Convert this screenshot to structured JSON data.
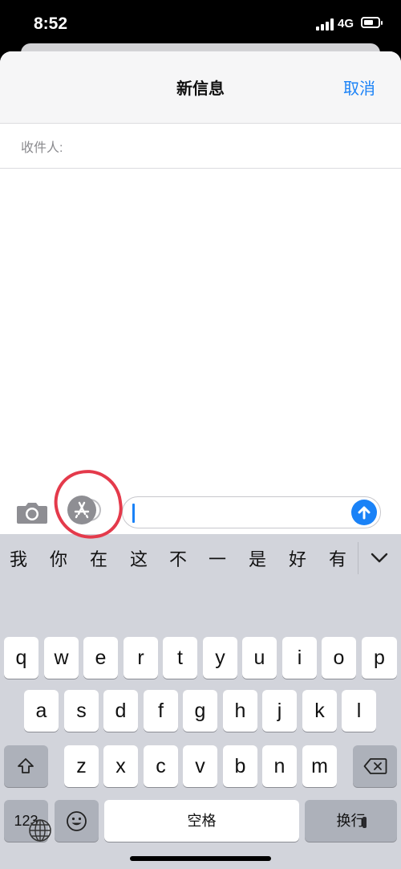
{
  "status": {
    "time": "8:52",
    "network": "4G"
  },
  "nav": {
    "title": "新信息",
    "cancel": "取消"
  },
  "to": {
    "label": "收件人:",
    "value": ""
  },
  "compose": {
    "text": ""
  },
  "candidates": [
    "我",
    "你",
    "在",
    "这",
    "不",
    "一",
    "是",
    "好",
    "有"
  ],
  "keys": {
    "row1": [
      "q",
      "w",
      "e",
      "r",
      "t",
      "y",
      "u",
      "i",
      "o",
      "p"
    ],
    "row2": [
      "a",
      "s",
      "d",
      "f",
      "g",
      "h",
      "j",
      "k",
      "l"
    ],
    "row3": [
      "z",
      "x",
      "c",
      "v",
      "b",
      "n",
      "m"
    ],
    "numbers": "123",
    "space": "空格",
    "return": "换行"
  },
  "colors": {
    "accent": "#1a82f7",
    "highlight": "#e43a4b",
    "keyboard_bg": "#d2d4db"
  }
}
